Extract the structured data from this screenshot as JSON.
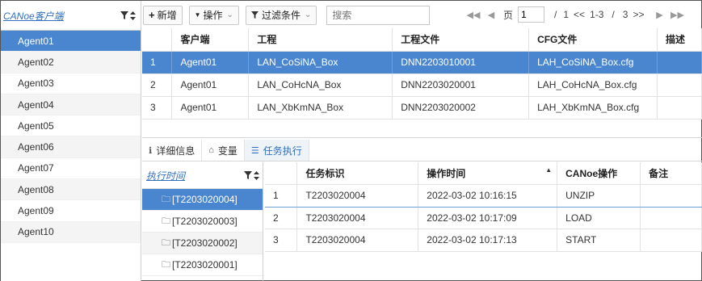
{
  "agents_panel": {
    "title": "CANoe客户端",
    "items": [
      "Agent01",
      "Agent02",
      "Agent03",
      "Agent04",
      "Agent05",
      "Agent06",
      "Agent07",
      "Agent08",
      "Agent09",
      "Agent10"
    ],
    "selected_index": 0
  },
  "toolbar": {
    "add_label": "新增",
    "operate_label": "操作",
    "filter_label": "过滤条件",
    "search_placeholder": "搜索"
  },
  "pager": {
    "page_label": "页",
    "page_value": "1",
    "separator": "/",
    "total_pages": "1",
    "prev_label": "<<",
    "range": "1-3",
    "range_separator": "/",
    "total_items": "3",
    "next_label": ">>"
  },
  "top_table": {
    "headers": [
      "",
      "客户端",
      "工程",
      "工程文件",
      "CFG文件",
      "描述"
    ],
    "rows": [
      [
        "1",
        "Agent01",
        "LAN_CoSiNA_Box",
        "DNN2203010001",
        "LAH_CoSiNA_Box.cfg",
        ""
      ],
      [
        "2",
        "Agent01",
        "LAN_CoHcNA_Box",
        "DNN2203020001",
        "LAH_CoHcNA_Box.cfg",
        ""
      ],
      [
        "3",
        "Agent01",
        "LAN_XbKmNA_Box",
        "DNN2203020002",
        "LAH_XbKmNA_Box.cfg",
        ""
      ]
    ],
    "selected_index": 0
  },
  "tabs": [
    {
      "label": "详细信息",
      "icon": "info-icon"
    },
    {
      "label": "变量",
      "icon": "drive-icon"
    },
    {
      "label": "任务执行",
      "icon": "list-icon"
    }
  ],
  "active_tab": 2,
  "exec_panel": {
    "title": "执行时间",
    "items": [
      "[T2203020004]",
      "[T2203020003]",
      "[T2203020002]",
      "[T2203020001]"
    ],
    "selected_index": 0
  },
  "task_table": {
    "headers": [
      "",
      "任务标识",
      "操作时间",
      "CANoe操作",
      "备注"
    ],
    "rows": [
      [
        "1",
        "T2203020004",
        "2022-03-02 10:16:15",
        "UNZIP",
        ""
      ],
      [
        "2",
        "T2203020004",
        "2022-03-02 10:17:09",
        "LOAD",
        ""
      ],
      [
        "3",
        "T2203020004",
        "2022-03-02 10:17:13",
        "START",
        ""
      ]
    ],
    "sorted_column": 2
  },
  "colors": {
    "selection": "#4a86cf",
    "link": "#2f6fbe",
    "alt_row": "#f4f4f4"
  }
}
